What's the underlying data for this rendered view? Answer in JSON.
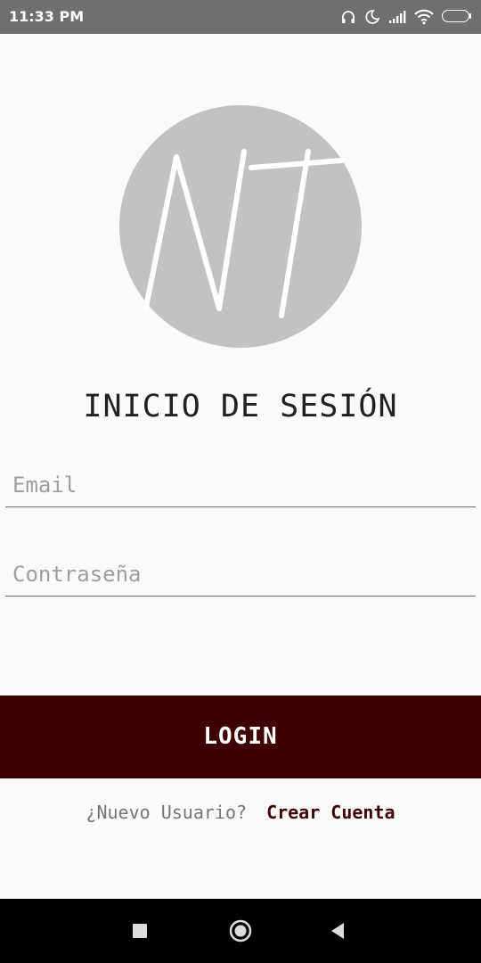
{
  "status_bar": {
    "time": "11:33 PM",
    "battery_level": "70",
    "icons": [
      "headphones-icon",
      "moon-icon",
      "signal-icon",
      "wifi-icon",
      "battery-icon"
    ]
  },
  "logo": {
    "monogram": "NT",
    "circle_color": "#c2c2c2",
    "stroke_color": "#ffffff"
  },
  "login": {
    "title": "INICIO DE SESIÓN",
    "email_placeholder": "Email",
    "email_value": "",
    "password_placeholder": "Contraseña",
    "password_value": "",
    "button_label": "LOGIN",
    "new_user_prompt": "¿Nuevo Usuario?",
    "create_account_link": "Crear Cuenta"
  },
  "colors": {
    "accent": "#3e0003",
    "background": "#fafafa",
    "status_bar": "#6f6f6f"
  },
  "nav_bar": {
    "buttons": [
      "recents-icon",
      "home-icon",
      "back-icon"
    ]
  }
}
